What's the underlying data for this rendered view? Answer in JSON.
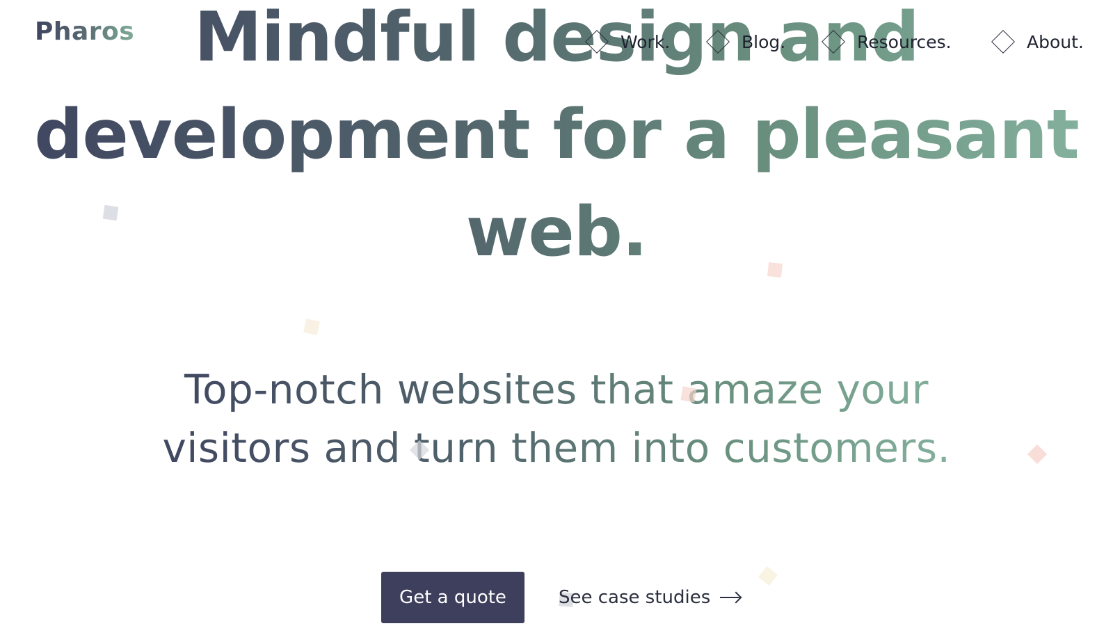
{
  "header": {
    "logo": "Pharos",
    "nav": [
      {
        "label": "Work."
      },
      {
        "label": "Blog."
      },
      {
        "label": "Resources."
      },
      {
        "label": "About."
      }
    ]
  },
  "hero": {
    "title_line1": "Mindful design and",
    "title_line2": "development for a pleasant",
    "title_line3": "web.",
    "subtitle_line1": "Top-notch websites that amaze your",
    "subtitle_line2": "visitors and turn them into customers."
  },
  "cta": {
    "primary_label": "Get a quote",
    "secondary_label": "See case studies",
    "secondary_icon": "arrow-right-icon"
  },
  "colors": {
    "gradient_start": "#3f4560",
    "gradient_mid": "#51636b",
    "gradient_end": "#86b3a0",
    "button_bg": "#3d3f5c",
    "text_dark": "#1f2330"
  }
}
